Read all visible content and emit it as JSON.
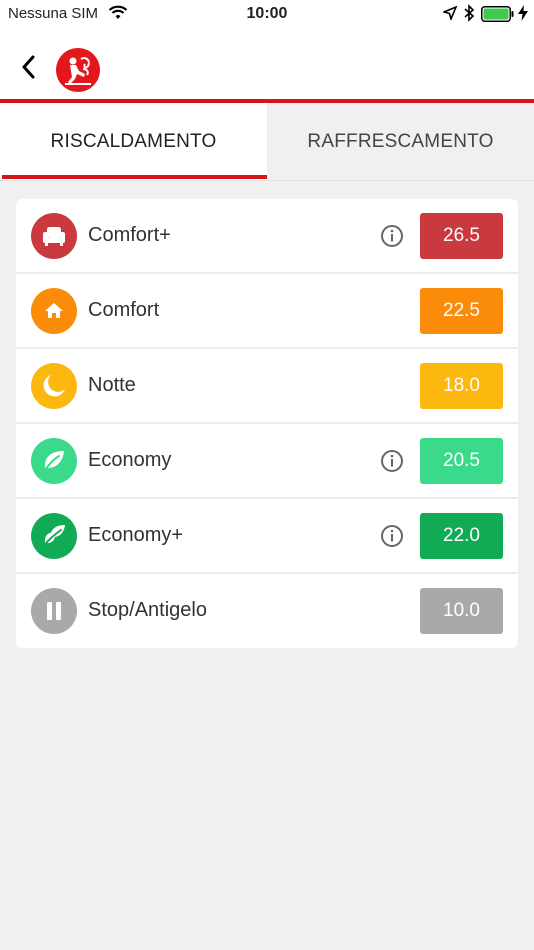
{
  "status_bar": {
    "carrier": "Nessuna SIM",
    "time": "10:00"
  },
  "nav": {
    "back_icon": "chevron-left-icon",
    "logo_icon": "brand-logo-icon"
  },
  "tabs": [
    {
      "label": "RISCALDAMENTO",
      "active": true
    },
    {
      "label": "RAFFRESCAMENTO",
      "active": false
    }
  ],
  "modes": [
    {
      "label": "Comfort+",
      "icon": "armchair-icon",
      "temperature": "26.5",
      "info": true,
      "color": "#c9393d"
    },
    {
      "label": "Comfort",
      "icon": "home-icon",
      "temperature": "22.5",
      "info": false,
      "color": "#fb8c0a"
    },
    {
      "label": "Notte",
      "icon": "moon-icon",
      "temperature": "18.0",
      "info": false,
      "color": "#fdb80f"
    },
    {
      "label": "Economy",
      "icon": "leaf-icon",
      "temperature": "20.5",
      "info": true,
      "color": "#3bd98a"
    },
    {
      "label": "Economy+",
      "icon": "double-leaf-icon",
      "temperature": "22.0",
      "info": true,
      "color": "#12ab55"
    },
    {
      "label": "Stop/Antigelo",
      "icon": "pause-icon",
      "temperature": "10.0",
      "info": false,
      "color": "#a9a9a9"
    }
  ],
  "colors": {
    "accent": "#d8141b",
    "background": "#f0f0f0"
  }
}
